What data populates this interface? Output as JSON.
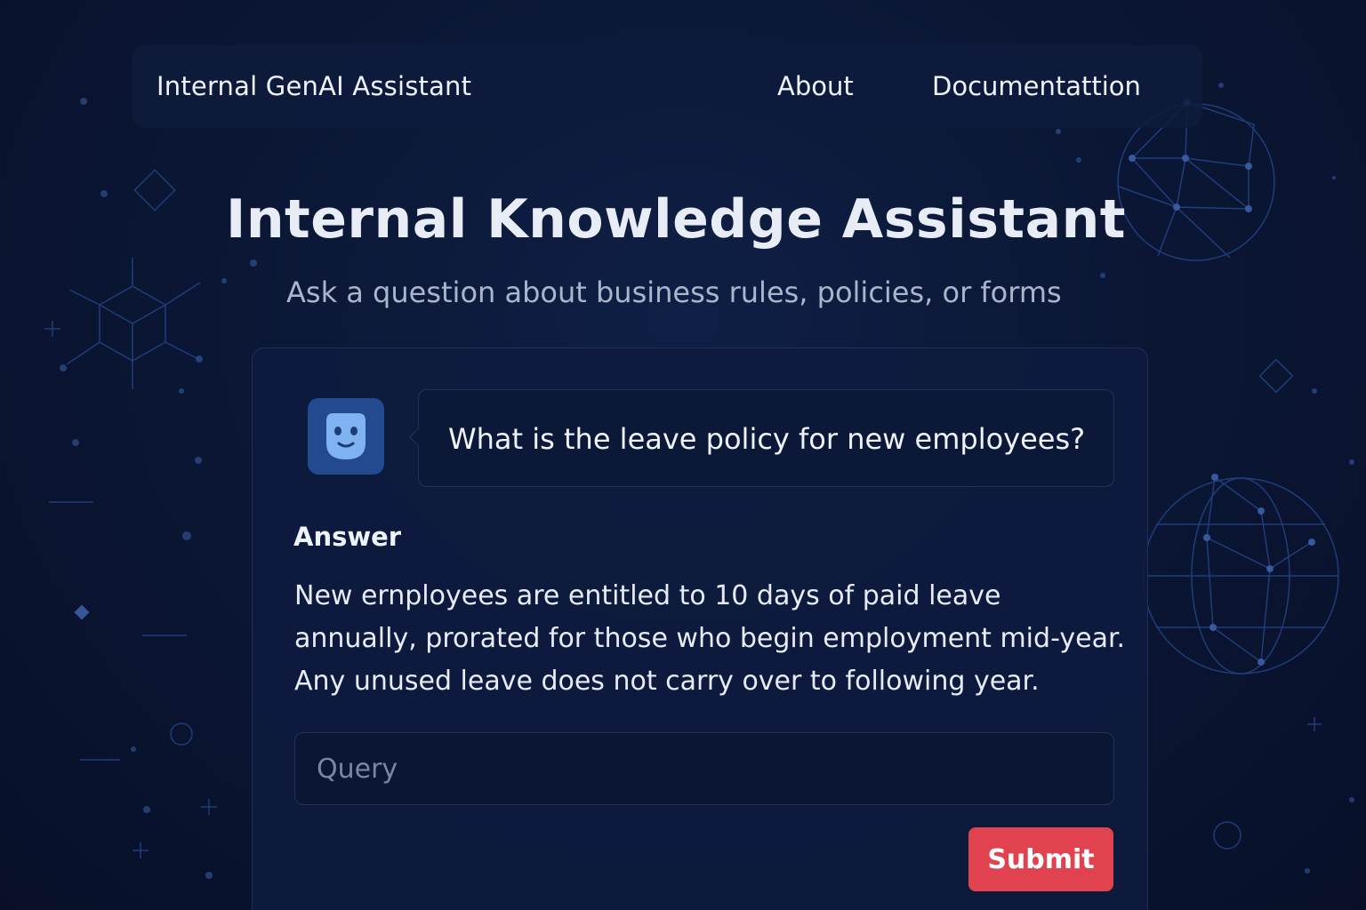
{
  "nav": {
    "brand": "Internal GenAI Assistant",
    "links": [
      "About",
      "Documentattion"
    ]
  },
  "header": {
    "title": "Internal Knowledge Assistant",
    "subtitle": "Ask a question about business rules, policies, or forms"
  },
  "chat": {
    "avatar_icon": "robot-face-icon",
    "question": "What is the leave policy for new employees?",
    "answer_heading": "Answer",
    "answer": "New ernployees are entitled to 10 days of paid leave annually, prorated for those who begin employment mid-year. Any unused leave does not carry over to following year."
  },
  "form": {
    "query_placeholder": "Query",
    "submit_label": "Submit"
  },
  "colors": {
    "background": "#0a1430",
    "card": "#0e1b3e",
    "avatar": "#234a8f",
    "submit": "#e0434f",
    "decor_lines": "#2a4f9a"
  }
}
